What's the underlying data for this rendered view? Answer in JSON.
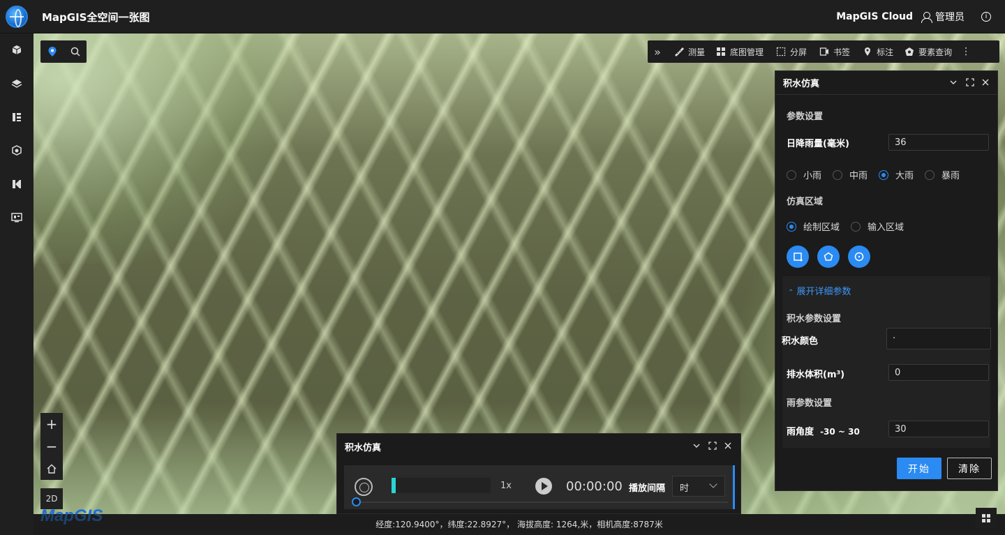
{
  "header": {
    "title": "MapGIS全空间一张图",
    "cloud": "MapGIS Cloud",
    "user": "管理员"
  },
  "sidebar": {
    "items": [
      {
        "icon": "cube-icon"
      },
      {
        "icon": "layers-icon"
      },
      {
        "icon": "catalog-icon"
      },
      {
        "icon": "model-icon"
      },
      {
        "icon": "analysis-icon"
      },
      {
        "icon": "screen-icon"
      }
    ]
  },
  "toolbar": {
    "items": [
      {
        "label": "测量",
        "icon": "ruler-icon"
      },
      {
        "label": "底图管理",
        "icon": "grid-icon"
      },
      {
        "label": "分屏",
        "icon": "split-icon"
      },
      {
        "label": "书签",
        "icon": "bookmark-icon"
      },
      {
        "label": "标注",
        "icon": "pin-icon"
      },
      {
        "label": "要素查询",
        "icon": "query-icon"
      }
    ]
  },
  "rightPanel": {
    "title": "积水仿真",
    "paramSection": "参数设置",
    "rainfallLabel": "日降雨量(毫米)",
    "rainfallValue": "36",
    "rainOptions": [
      "小雨",
      "中雨",
      "大雨",
      "暴雨"
    ],
    "rainSelected": "大雨",
    "regionSection": "仿真区域",
    "regionOptions": [
      "绘制区域",
      "输入区域"
    ],
    "regionSelected": "绘制区域",
    "expandLabel": "展开详细参数",
    "waterSection": "积水参数设置",
    "waterColorLabel": "积水颜色",
    "waterColorValue": "·",
    "drainLabel": "排水体积(m³)",
    "drainValue": "0",
    "rainParamSection": "雨参数设置",
    "rainAngleLabel": "雨角度",
    "rainAngleRange": "-30 ~ 30",
    "rainAngleValue": "30",
    "startLabel": "开始",
    "clearLabel": "清除"
  },
  "bottomPanel": {
    "title": "积水仿真",
    "speed": "1x",
    "time": "00:00:00",
    "intervalLabel": "播放间隔",
    "intervalValue": "时",
    "progress": 0.04
  },
  "map": {
    "zoomIn": "+",
    "zoomOut": "−",
    "mode2d": "2D",
    "watermark": "MapGIS",
    "status": "经度:120.9400°，纬度:22.8927°，  海拔高度: 1264,米，相机高度:8787米"
  },
  "colors": {
    "accent": "#2b8bf2",
    "progress": "#2ad4d4"
  }
}
